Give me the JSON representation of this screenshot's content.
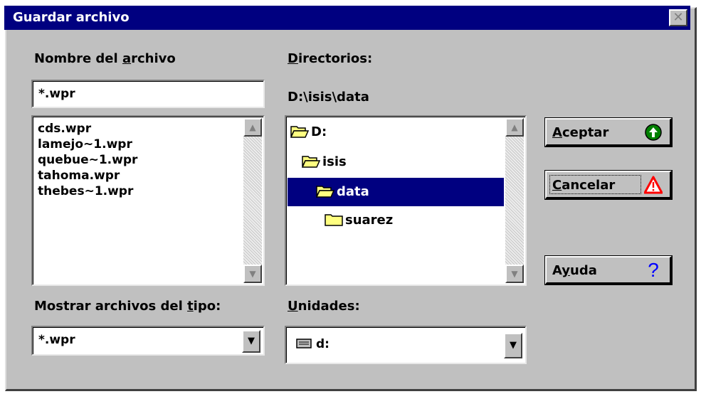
{
  "dialog": {
    "title": "Guardar archivo",
    "close_label": "✕"
  },
  "filename": {
    "label": "Nombre del archivo",
    "value": "*.wpr",
    "files": [
      "cds.wpr",
      "lamejo~1.wpr",
      "quebue~1.wpr",
      "tahoma.wpr",
      "thebes~1.wpr"
    ]
  },
  "directories": {
    "label": "Directorios:",
    "current_path": "D:\\isis\\data",
    "items": [
      {
        "name": "D:",
        "icon": "open-folder-icon",
        "selected": false
      },
      {
        "name": "isis",
        "icon": "open-folder-icon",
        "selected": false
      },
      {
        "name": "data",
        "icon": "open-folder-icon",
        "selected": true
      },
      {
        "name": "suarez",
        "icon": "closed-folder-icon",
        "selected": false
      }
    ]
  },
  "file_type": {
    "label": "Mostrar archivos del tipo:",
    "selected": "*.wpr"
  },
  "drives": {
    "label": "Unidades:",
    "selected": "d:",
    "icon": "drive-icon"
  },
  "buttons": {
    "accept": "Aceptar",
    "cancel": "Cancelar",
    "help": "Ayuda"
  },
  "colors": {
    "title_bar": "#000080",
    "selection": "#000080",
    "dialog_face": "#c0c0c0",
    "folder": "#ffff80",
    "ok_green": "#008000",
    "warning_red": "#ff0000",
    "help_blue": "#0000ff"
  }
}
